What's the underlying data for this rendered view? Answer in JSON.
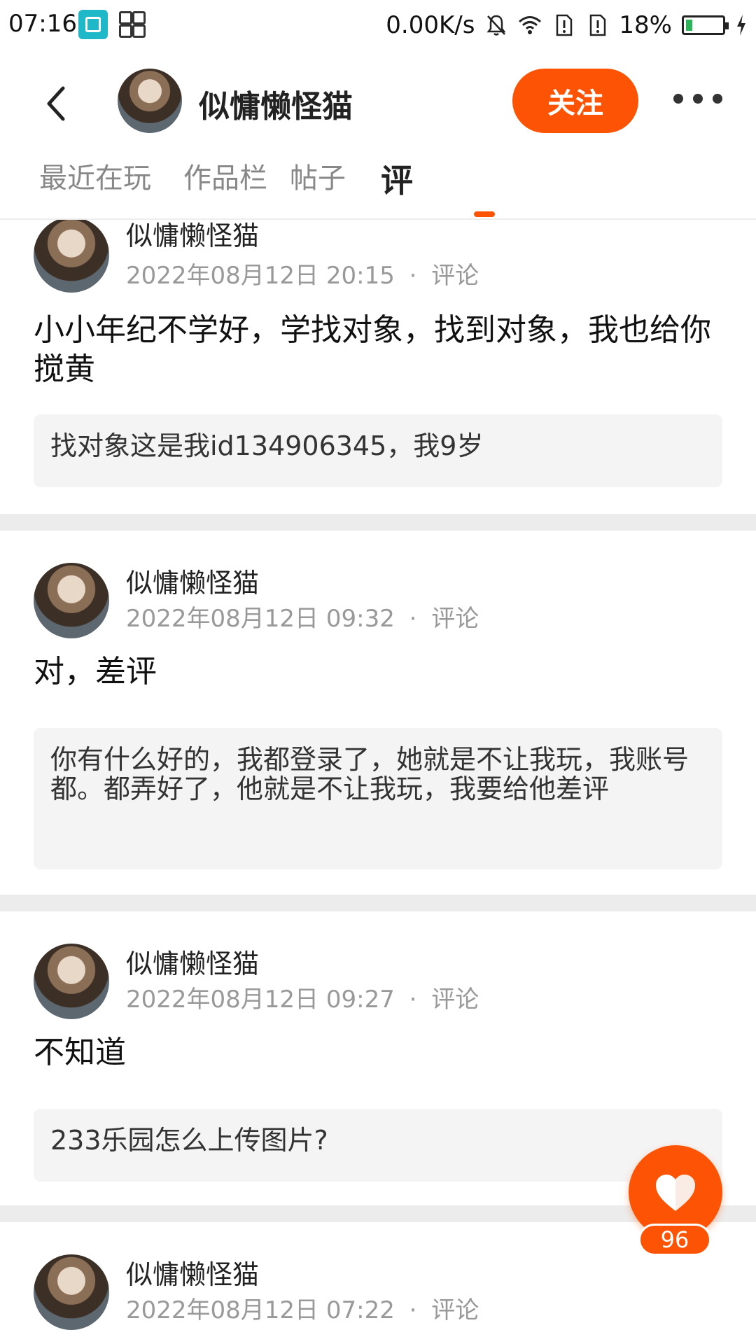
{
  "status_bar": {
    "time": "07:16",
    "net_speed": "0.00K/s",
    "battery_percent": "18%",
    "battery_level": 0.18,
    "icons": [
      "screen-scan-icon",
      "apps-icon",
      "mute-bell-icon",
      "wifi-icon",
      "sim1-icon",
      "sim2-icon",
      "battery-icon",
      "charging-icon"
    ]
  },
  "header": {
    "username": "似慵懒怪猫",
    "follow_label": "关注",
    "accent_color": "#fc5404"
  },
  "tabs": [
    {
      "label": "最近在玩",
      "active": false
    },
    {
      "label": "作品栏",
      "active": false
    },
    {
      "label": "帖子",
      "active": false
    },
    {
      "label": "评",
      "active": true
    }
  ],
  "feed": [
    {
      "author": "似慵懒怪猫",
      "time": "2022年08月12日 20:15",
      "type": "评论",
      "text": "小小年纪不学好，学找对象，找到对象，我也给你搅黄",
      "quote": "找对象这是我id134906345，我9岁"
    },
    {
      "author": "似慵懒怪猫",
      "time": "2022年08月12日 09:32",
      "type": "评论",
      "text": "对，差评",
      "quote": "你有什么好的，我都登录了，她就是不让我玩，我账号都。都弄好了，他就是不让我玩，我要给他差评"
    },
    {
      "author": "似慵懒怪猫",
      "time": "2022年08月12日 09:27",
      "type": "评论",
      "text": "不知道",
      "quote": "233乐园怎么上传图片?"
    },
    {
      "author": "似慵懒怪猫",
      "time": "2022年08月12日 07:22",
      "type": "评论",
      "text": "",
      "quote": ""
    }
  ],
  "like": {
    "count": "96"
  },
  "separator": "·"
}
